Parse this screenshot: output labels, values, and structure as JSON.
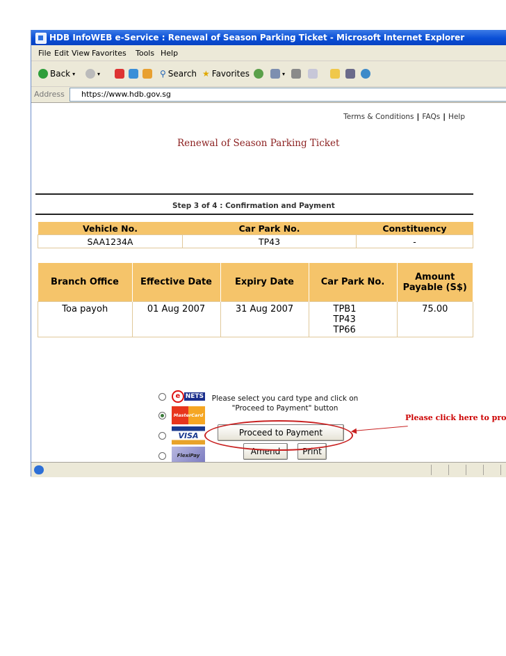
{
  "window": {
    "title": "HDB InfoWEB e-Service : Renewal of Season Parking Ticket - Microsoft Internet Explorer"
  },
  "menu": [
    "File",
    "Edit",
    "View",
    "Favorites",
    "Tools",
    "Help"
  ],
  "toolbar": {
    "back": "Back",
    "search": "Search",
    "favorites": "Favorites"
  },
  "address": {
    "label": "Address",
    "url": "https://www.hdb.gov.sg"
  },
  "links": {
    "terms": "Terms & Conditions",
    "faqs": "FAQs",
    "help": "Help",
    "sep": "|"
  },
  "page": {
    "title": "Renewal of Season Parking Ticket",
    "step": "Step 3 of 4 : Confirmation and Payment"
  },
  "vehicle_table": {
    "headers": [
      "Vehicle No.",
      "Car Park No.",
      "Constituency"
    ],
    "row": [
      "SAA1234A",
      "TP43",
      "-"
    ]
  },
  "ticket_table": {
    "headers": [
      "Branch Office",
      "Effective Date",
      "Expiry Date",
      "Car Park No.",
      "Amount Payable (S$)"
    ],
    "row": {
      "branch": "Toa payoh",
      "effective": "01 Aug 2007",
      "expiry": "31 Aug 2007",
      "carparks": [
        "TPB1",
        "TP43",
        "TP66"
      ],
      "amount": "75.00"
    }
  },
  "payment": {
    "cards": [
      {
        "name": "NETS",
        "selected": false,
        "icon": "nets-logo"
      },
      {
        "name": "MasterCard",
        "selected": true,
        "icon": "mastercard-logo"
      },
      {
        "name": "VISA",
        "selected": false,
        "icon": "visa-logo"
      },
      {
        "name": "FlexiPay",
        "selected": false,
        "icon": "flexipay-logo"
      }
    ],
    "instruction": "Please select you card type and click on \"Proceed to Payment\" button",
    "proceed": "Proceed to Payment",
    "amend": "Amend",
    "print": "Print"
  },
  "annotation": {
    "text": "Please click here to proc",
    "color": "#c00000"
  },
  "colors": {
    "header_bg": "#f5c46a",
    "title_color": "#8b1f1f"
  }
}
